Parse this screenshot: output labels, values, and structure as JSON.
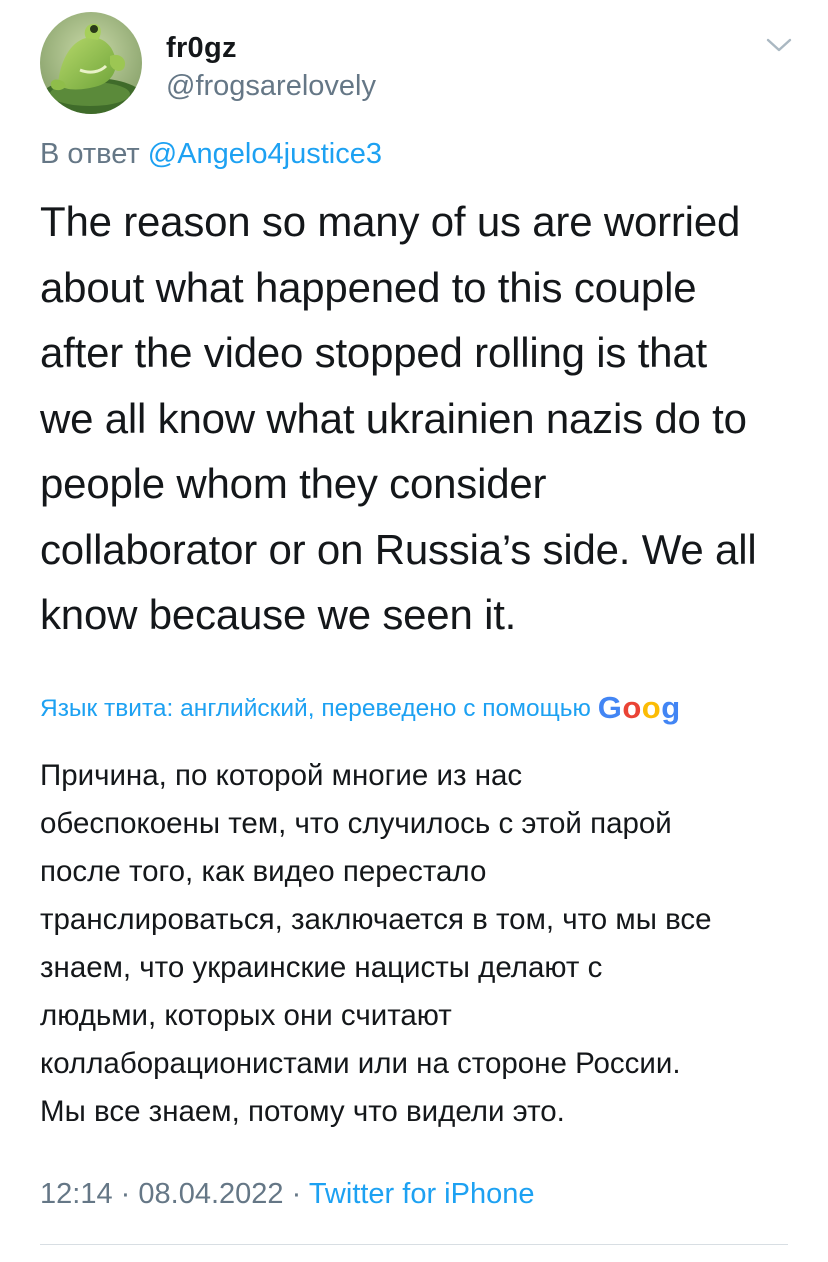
{
  "author": {
    "display_name": "fr0gz",
    "handle": "@frogsarelovely",
    "avatar_icon": "frog-avatar-icon"
  },
  "menu": {
    "icon": "chevron-down-icon"
  },
  "reply": {
    "prefix": "В ответ",
    "mention": "@Angelo4justice3"
  },
  "tweet": {
    "lines": [
      "The reason so many of us are worried",
      "about what happened to this couple",
      "after the video stopped rolling is that",
      "we all know what ukrainien nazis do to",
      "people whom they consider",
      "collaborator or on Russia’s side. We all",
      "know because we seen it."
    ]
  },
  "translation": {
    "label": "Язык твита: английский, переведено с помощью",
    "provider": "Google",
    "lines": [
      "Причина, по которой многие из нас",
      "обеспокоены тем, что случилось с этой парой",
      "после того, как видео перестало",
      "транслироваться, заключается в том, что мы все",
      "знаем, что украинские нацисты делают с",
      "людьми, которых они считают",
      "коллаборационистами или на стороне России.",
      "Мы все знаем, потому что видели это."
    ]
  },
  "meta": {
    "time": "12:14",
    "separator": "·",
    "date": "08.04.2022",
    "source": "Twitter for iPhone"
  },
  "colors": {
    "link": "#1da1f2",
    "secondary_text": "#657786",
    "primary_text": "#14171a"
  }
}
